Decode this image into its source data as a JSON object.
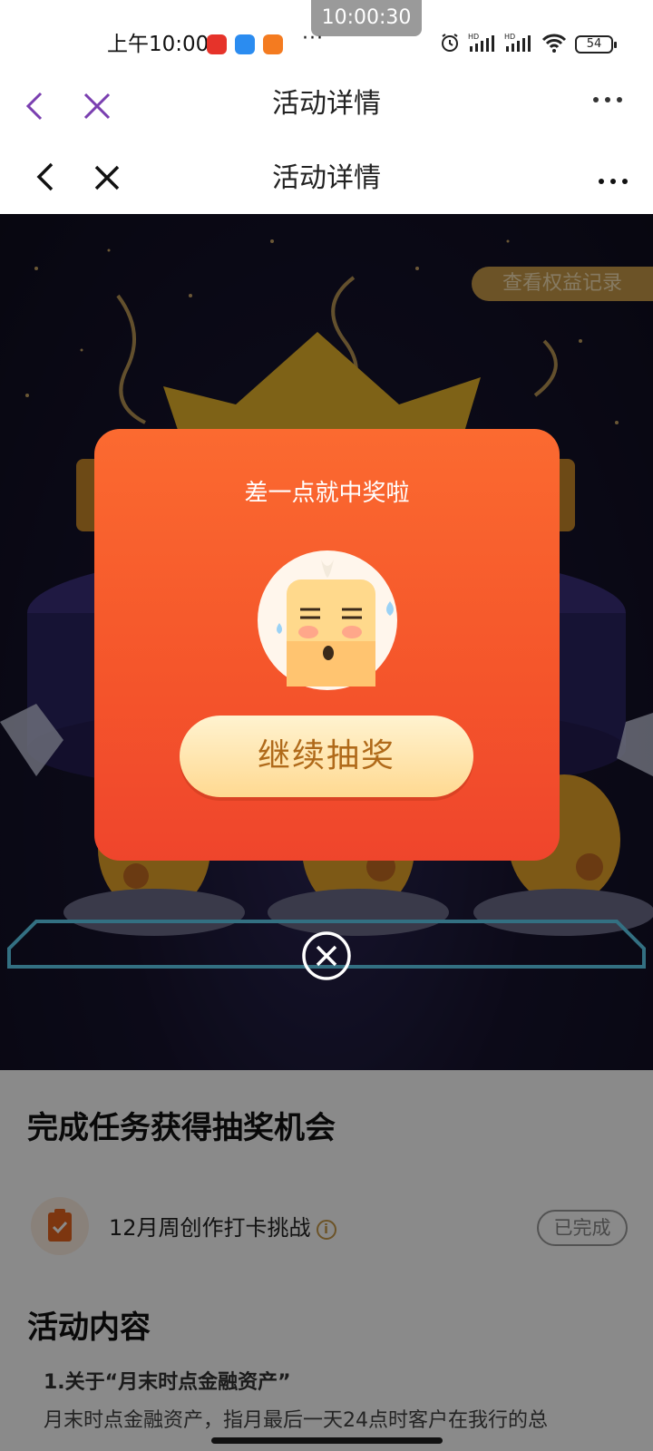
{
  "status_bar": {
    "recording_time": "10:00:30",
    "time": "上午10:00",
    "more": "···",
    "battery": "54",
    "icons": [
      "weibo-app-icon",
      "blue-app-icon",
      "orange-app-icon",
      "alarm-icon",
      "hd-signal-icon",
      "hd-signal-icon",
      "wifi-icon",
      "battery-icon"
    ]
  },
  "nav_outer": {
    "title": "活动详情",
    "back_icon": "chevron-left-icon",
    "close_icon": "close-icon",
    "more_icon": "more-icon"
  },
  "nav_inner": {
    "title": "活动详情",
    "back_icon": "chevron-left-icon",
    "close_icon": "close-icon",
    "more_icon": "more-icon"
  },
  "hero": {
    "rights_link": "查看权益记录"
  },
  "tasks": {
    "heading": "完成任务获得抽奖机会",
    "items": [
      {
        "name": "12月周创作打卡挑战",
        "info": "i",
        "status": "已完成"
      }
    ]
  },
  "activity": {
    "heading": "活动内容",
    "sub_title": "1.关于“月末时点金融资产”",
    "paragraph": "月末时点金融资产，指月最后一天24点时客户在我行的总"
  },
  "dialog": {
    "title": "差一点就中奖啦",
    "button": "继续抽奖",
    "mascot_icon": "sad-face-icon",
    "close_icon": "close-circle-icon"
  },
  "colors": {
    "dialog_top": "#fb6a30",
    "dialog_bottom": "#ef452c",
    "button_text": "#b06a1a",
    "nav_outer_accent": "#7a3fb0",
    "gold": "#c79a49"
  }
}
